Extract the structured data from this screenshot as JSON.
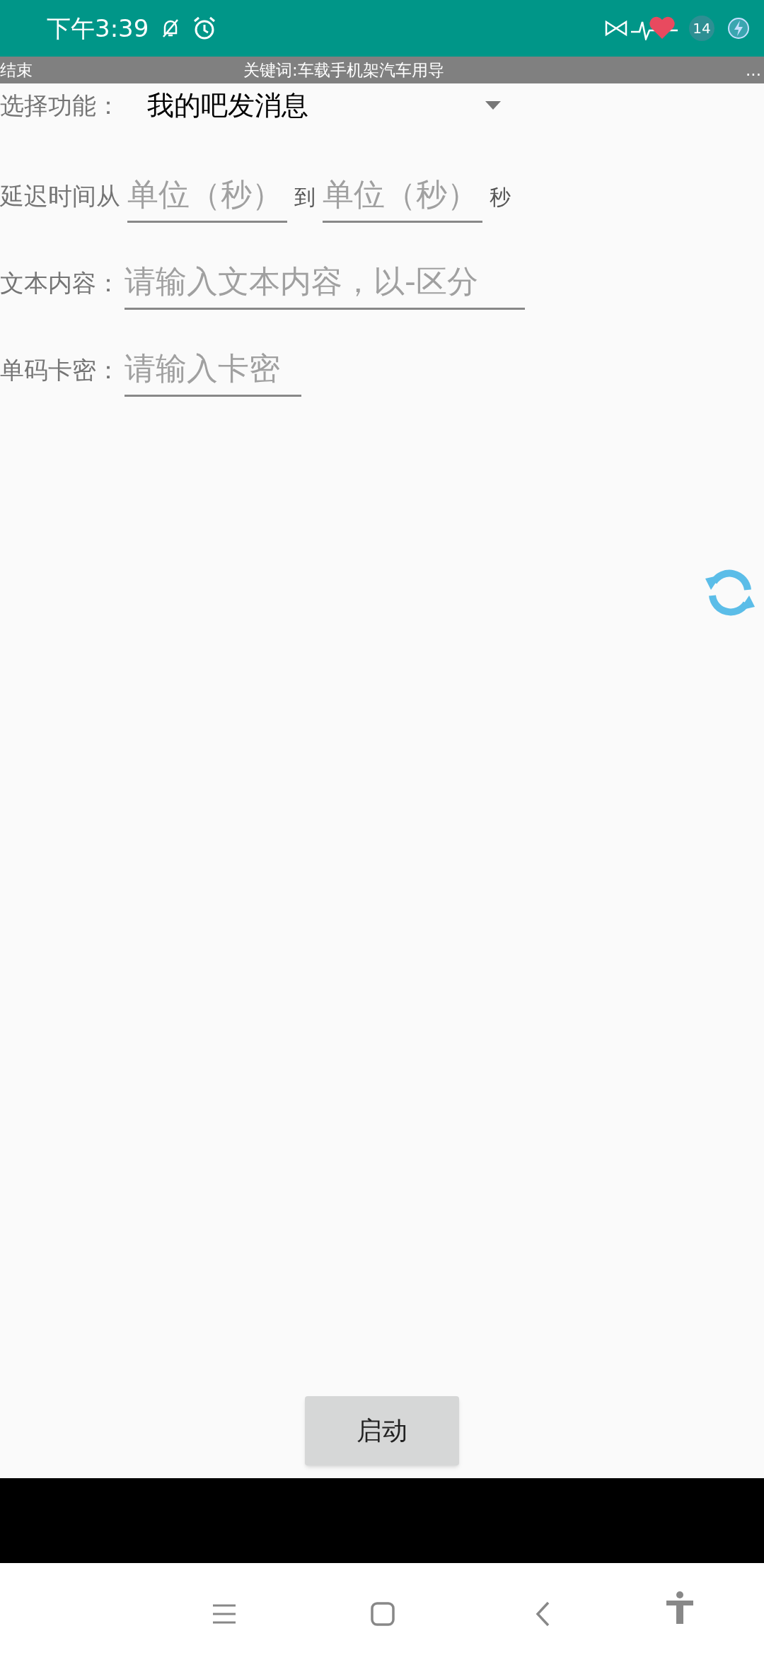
{
  "status_bar": {
    "time": "下午3:39",
    "battery_level_text": "14"
  },
  "banner": {
    "left": "结束",
    "center": "关键词:车载手机架汽车用导",
    "right": "..."
  },
  "form": {
    "function_label": "选择功能：",
    "function_value": "我的吧发消息",
    "delay_label": "延迟时间从",
    "delay_from_placeholder": "单位（秒）",
    "delay_to_label": "到",
    "delay_to_placeholder": "单位（秒）",
    "delay_unit": "秒",
    "text_label": "文本内容：",
    "text_placeholder": "请输入文本内容，以-区分",
    "card_label": "单码卡密：",
    "card_placeholder": "请输入卡密"
  },
  "start_button": "启动"
}
